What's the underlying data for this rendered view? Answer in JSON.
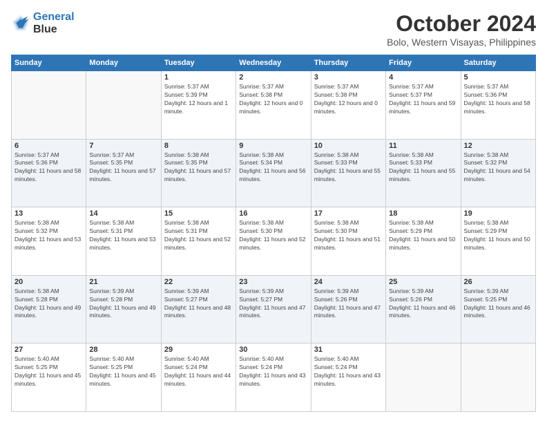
{
  "header": {
    "logo_line1": "General",
    "logo_line2": "Blue",
    "month_title": "October 2024",
    "location": "Bolo, Western Visayas, Philippines"
  },
  "days_of_week": [
    "Sunday",
    "Monday",
    "Tuesday",
    "Wednesday",
    "Thursday",
    "Friday",
    "Saturday"
  ],
  "weeks": [
    [
      {
        "day": "",
        "sunrise": "",
        "sunset": "",
        "daylight": ""
      },
      {
        "day": "",
        "sunrise": "",
        "sunset": "",
        "daylight": ""
      },
      {
        "day": "1",
        "sunrise": "Sunrise: 5:37 AM",
        "sunset": "Sunset: 5:39 PM",
        "daylight": "Daylight: 12 hours and 1 minute."
      },
      {
        "day": "2",
        "sunrise": "Sunrise: 5:37 AM",
        "sunset": "Sunset: 5:38 PM",
        "daylight": "Daylight: 12 hours and 0 minutes."
      },
      {
        "day": "3",
        "sunrise": "Sunrise: 5:37 AM",
        "sunset": "Sunset: 5:38 PM",
        "daylight": "Daylight: 12 hours and 0 minutes."
      },
      {
        "day": "4",
        "sunrise": "Sunrise: 5:37 AM",
        "sunset": "Sunset: 5:37 PM",
        "daylight": "Daylight: 11 hours and 59 minutes."
      },
      {
        "day": "5",
        "sunrise": "Sunrise: 5:37 AM",
        "sunset": "Sunset: 5:36 PM",
        "daylight": "Daylight: 11 hours and 58 minutes."
      }
    ],
    [
      {
        "day": "6",
        "sunrise": "Sunrise: 5:37 AM",
        "sunset": "Sunset: 5:36 PM",
        "daylight": "Daylight: 11 hours and 58 minutes."
      },
      {
        "day": "7",
        "sunrise": "Sunrise: 5:37 AM",
        "sunset": "Sunset: 5:35 PM",
        "daylight": "Daylight: 11 hours and 57 minutes."
      },
      {
        "day": "8",
        "sunrise": "Sunrise: 5:38 AM",
        "sunset": "Sunset: 5:35 PM",
        "daylight": "Daylight: 11 hours and 57 minutes."
      },
      {
        "day": "9",
        "sunrise": "Sunrise: 5:38 AM",
        "sunset": "Sunset: 5:34 PM",
        "daylight": "Daylight: 11 hours and 56 minutes."
      },
      {
        "day": "10",
        "sunrise": "Sunrise: 5:38 AM",
        "sunset": "Sunset: 5:33 PM",
        "daylight": "Daylight: 11 hours and 55 minutes."
      },
      {
        "day": "11",
        "sunrise": "Sunrise: 5:38 AM",
        "sunset": "Sunset: 5:33 PM",
        "daylight": "Daylight: 11 hours and 55 minutes."
      },
      {
        "day": "12",
        "sunrise": "Sunrise: 5:38 AM",
        "sunset": "Sunset: 5:32 PM",
        "daylight": "Daylight: 11 hours and 54 minutes."
      }
    ],
    [
      {
        "day": "13",
        "sunrise": "Sunrise: 5:38 AM",
        "sunset": "Sunset: 5:32 PM",
        "daylight": "Daylight: 11 hours and 53 minutes."
      },
      {
        "day": "14",
        "sunrise": "Sunrise: 5:38 AM",
        "sunset": "Sunset: 5:31 PM",
        "daylight": "Daylight: 11 hours and 53 minutes."
      },
      {
        "day": "15",
        "sunrise": "Sunrise: 5:38 AM",
        "sunset": "Sunset: 5:31 PM",
        "daylight": "Daylight: 11 hours and 52 minutes."
      },
      {
        "day": "16",
        "sunrise": "Sunrise: 5:38 AM",
        "sunset": "Sunset: 5:30 PM",
        "daylight": "Daylight: 11 hours and 52 minutes."
      },
      {
        "day": "17",
        "sunrise": "Sunrise: 5:38 AM",
        "sunset": "Sunset: 5:30 PM",
        "daylight": "Daylight: 11 hours and 51 minutes."
      },
      {
        "day": "18",
        "sunrise": "Sunrise: 5:38 AM",
        "sunset": "Sunset: 5:29 PM",
        "daylight": "Daylight: 11 hours and 50 minutes."
      },
      {
        "day": "19",
        "sunrise": "Sunrise: 5:38 AM",
        "sunset": "Sunset: 5:29 PM",
        "daylight": "Daylight: 11 hours and 50 minutes."
      }
    ],
    [
      {
        "day": "20",
        "sunrise": "Sunrise: 5:38 AM",
        "sunset": "Sunset: 5:28 PM",
        "daylight": "Daylight: 11 hours and 49 minutes."
      },
      {
        "day": "21",
        "sunrise": "Sunrise: 5:39 AM",
        "sunset": "Sunset: 5:28 PM",
        "daylight": "Daylight: 11 hours and 49 minutes."
      },
      {
        "day": "22",
        "sunrise": "Sunrise: 5:39 AM",
        "sunset": "Sunset: 5:27 PM",
        "daylight": "Daylight: 11 hours and 48 minutes."
      },
      {
        "day": "23",
        "sunrise": "Sunrise: 5:39 AM",
        "sunset": "Sunset: 5:27 PM",
        "daylight": "Daylight: 11 hours and 47 minutes."
      },
      {
        "day": "24",
        "sunrise": "Sunrise: 5:39 AM",
        "sunset": "Sunset: 5:26 PM",
        "daylight": "Daylight: 11 hours and 47 minutes."
      },
      {
        "day": "25",
        "sunrise": "Sunrise: 5:39 AM",
        "sunset": "Sunset: 5:26 PM",
        "daylight": "Daylight: 11 hours and 46 minutes."
      },
      {
        "day": "26",
        "sunrise": "Sunrise: 5:39 AM",
        "sunset": "Sunset: 5:25 PM",
        "daylight": "Daylight: 11 hours and 46 minutes."
      }
    ],
    [
      {
        "day": "27",
        "sunrise": "Sunrise: 5:40 AM",
        "sunset": "Sunset: 5:25 PM",
        "daylight": "Daylight: 11 hours and 45 minutes."
      },
      {
        "day": "28",
        "sunrise": "Sunrise: 5:40 AM",
        "sunset": "Sunset: 5:25 PM",
        "daylight": "Daylight: 11 hours and 45 minutes."
      },
      {
        "day": "29",
        "sunrise": "Sunrise: 5:40 AM",
        "sunset": "Sunset: 5:24 PM",
        "daylight": "Daylight: 11 hours and 44 minutes."
      },
      {
        "day": "30",
        "sunrise": "Sunrise: 5:40 AM",
        "sunset": "Sunset: 5:24 PM",
        "daylight": "Daylight: 11 hours and 43 minutes."
      },
      {
        "day": "31",
        "sunrise": "Sunrise: 5:40 AM",
        "sunset": "Sunset: 5:24 PM",
        "daylight": "Daylight: 11 hours and 43 minutes."
      },
      {
        "day": "",
        "sunrise": "",
        "sunset": "",
        "daylight": ""
      },
      {
        "day": "",
        "sunrise": "",
        "sunset": "",
        "daylight": ""
      }
    ]
  ]
}
